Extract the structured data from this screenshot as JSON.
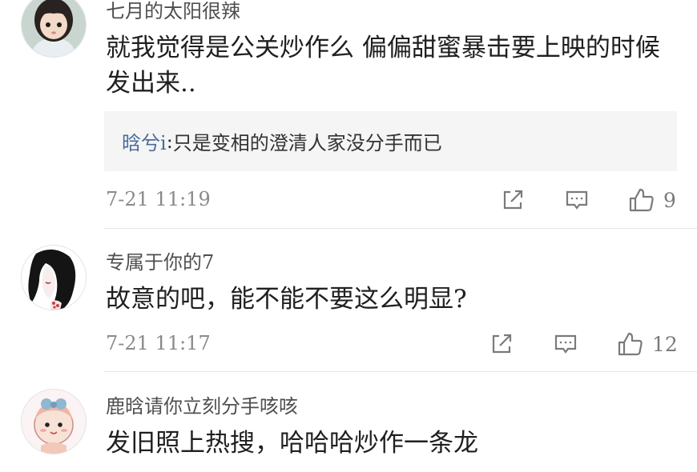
{
  "comments": [
    {
      "username": "七月的太阳很辣",
      "text": "就我觉得是公关炒作么 偏偏甜蜜暴击要上映的时候发出来..",
      "reply": {
        "name": "晗兮i",
        "separator": ":",
        "text": " 只是变相的澄清人家没分手而已"
      },
      "time": "7-21 11:19",
      "likes": "9"
    },
    {
      "username": "专属于你的7",
      "text": "故意的吧，能不能不要这么明显?",
      "time": "7-21 11:17",
      "likes": "12"
    },
    {
      "username": "鹿晗请你立刻分手咳咳",
      "text": "发旧照上热搜，哈哈哈炒作一条龙"
    }
  ],
  "icons": {
    "share": "share-icon",
    "reply": "comment-icon",
    "like": "thumbs-up-icon"
  },
  "colors": {
    "username": "#4f4f4f",
    "reply_name": "#4a6c9b",
    "meta": "#8a8a8a",
    "reply_bg": "#f5f5f5"
  }
}
